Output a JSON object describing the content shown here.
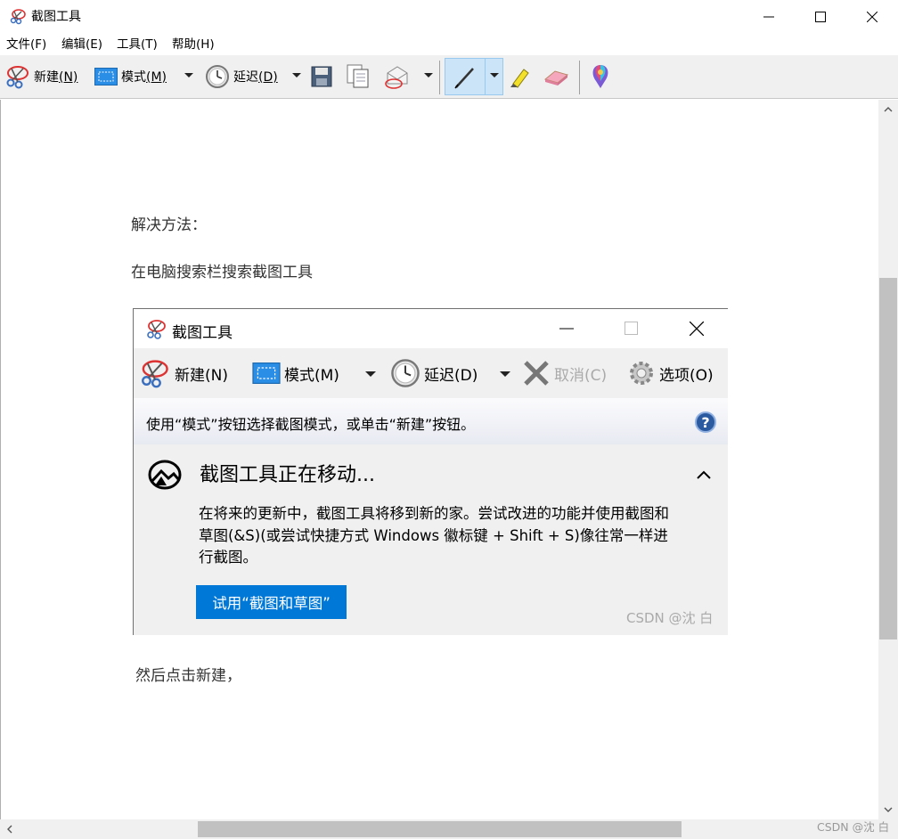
{
  "window": {
    "title": "截图工具",
    "controls": {
      "minimize": "minimize",
      "maximize": "maximize",
      "close": "close"
    }
  },
  "menu": [
    {
      "label": "文件(F)"
    },
    {
      "label": "编辑(E)"
    },
    {
      "label": "工具(T)"
    },
    {
      "label": "帮助(H)"
    }
  ],
  "toolbar": {
    "new": {
      "label": "新建",
      "key": "(N)",
      "icon": "scissors-icon"
    },
    "mode": {
      "label": "模式",
      "key": "(M)",
      "icon": "rect-select-icon"
    },
    "delay": {
      "label": "延迟",
      "key": "(D)",
      "icon": "clock-icon"
    },
    "save_icon": "save-icon",
    "copy_icon": "copy-icon",
    "send_icon": "email-icon",
    "pen_icon": "pen-icon",
    "highlighter_icon": "highlighter-icon",
    "eraser_icon": "eraser-icon",
    "paint3d_icon": "paint3d-icon"
  },
  "document": {
    "line1": "解决方法：",
    "line2": "在电脑搜索栏搜索截图工具",
    "line3": "然后点击新建，"
  },
  "embedded": {
    "title": "截图工具",
    "toolbar": {
      "new": "新建(N)",
      "mode": "模式(M)",
      "delay": "延迟(D)",
      "cancel": "取消(C)",
      "options": "选项(O)"
    },
    "hint": "使用“模式”按钮选择截图模式，或单击“新建”按钮。",
    "notice_title": "截图工具正在移动...",
    "notice_body": "在将来的更新中，截图工具将移到新的家。尝试改进的功能并使用截图和草图(&S)(或尝试快捷方式 Windows 徽标键 + Shift + S)像往常一样进行截图。",
    "try_button": "试用“截图和草图”",
    "watermark": "CSDN @沈 白"
  },
  "outer_watermark": "CSDN @沈 白",
  "colors": {
    "toolbar_bg": "#f0f0f0",
    "selected_tool_bg": "#cce4f7",
    "try_button_bg": "#0078d7",
    "scrollbar_thumb": "#c1c1c1"
  }
}
